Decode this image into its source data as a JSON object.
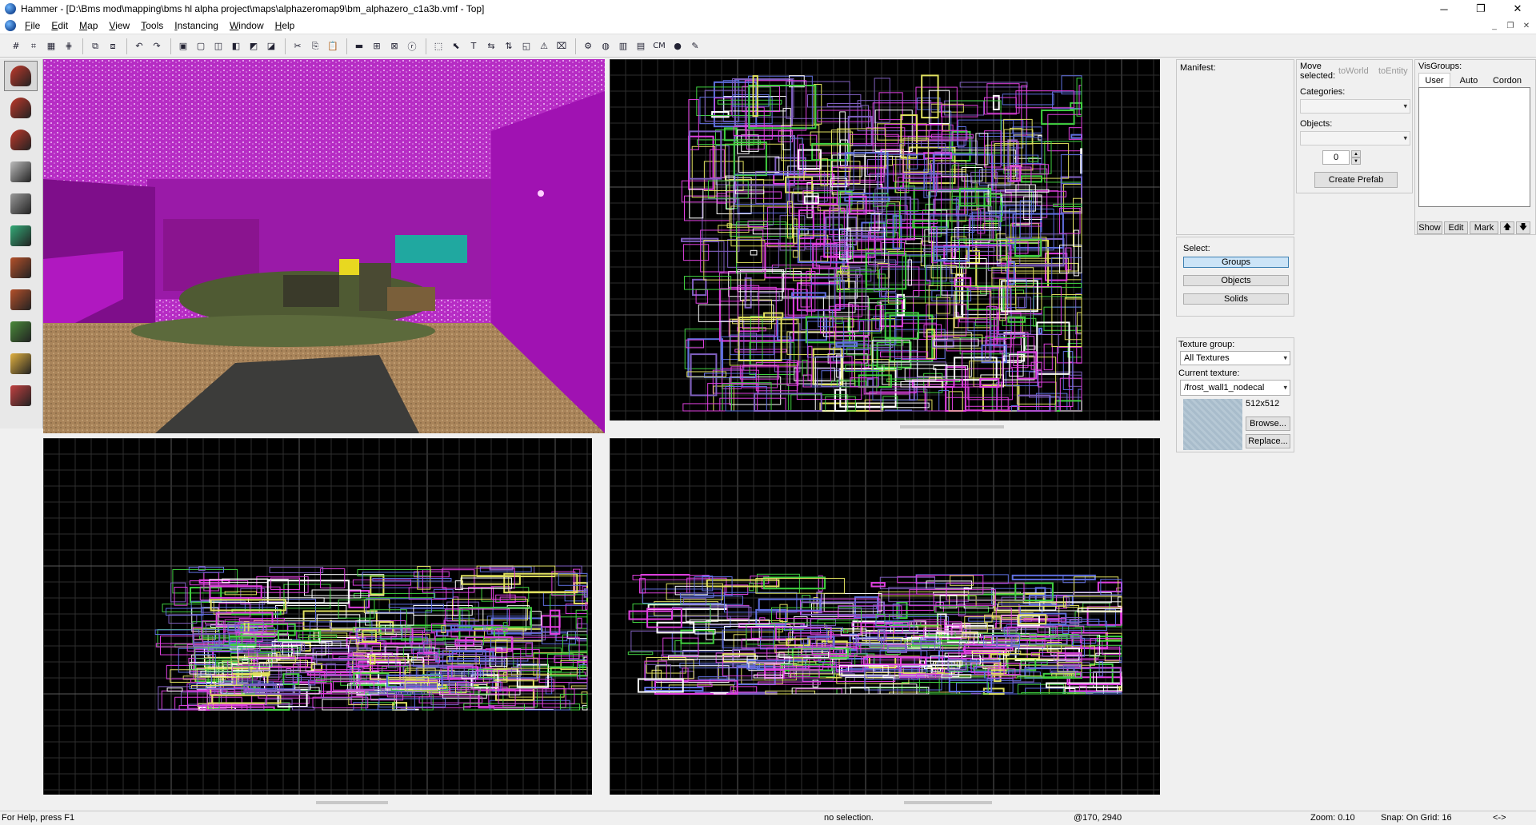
{
  "window": {
    "title": "Hammer - [D:\\Bms mod\\mapping\\bms hl alpha project\\maps\\alphazeromap9\\bm_alphazero_c1a3b.vmf - Top]",
    "controls": {
      "minimize": "─",
      "restore": "❐",
      "close": "✕"
    }
  },
  "menu": [
    "File",
    "Edit",
    "Map",
    "View",
    "Tools",
    "Instancing",
    "Window",
    "Help"
  ],
  "mdi_controls": {
    "minimize": "_",
    "restore": "❐",
    "close": "✕"
  },
  "toolbar_icons": [
    "grid-toggle",
    "grid-3d",
    "grid-dots",
    "grid-hash",
    "group",
    "ungroup",
    "undo",
    "redo",
    "carve",
    "hollow",
    "tie-to-entity",
    "move-to-world",
    "hide",
    "unhide",
    "cut",
    "copy",
    "paste",
    "wireframe",
    "toggle-texlock",
    "toggle-texscale",
    "ignore-groups",
    "selection-box",
    "select-cursor",
    "text-tool",
    "flip-h",
    "flip-v",
    "entity-report",
    "check-problems",
    "cordon",
    "map-properties",
    "toggle-3d-grid",
    "toggle-models",
    "toggle-sprites",
    "cm",
    "compile",
    "draw-mode"
  ],
  "toolbar_text": {
    "cm": "CM"
  },
  "left_tools": [
    {
      "name": "selection-tool-icon",
      "color": "#c0392b"
    },
    {
      "name": "magnify-tool-icon",
      "color": "#c0392b"
    },
    {
      "name": "camera-tool-icon",
      "color": "#c0392b"
    },
    {
      "name": "entity-tool-icon",
      "color": "#bbbbbb"
    },
    {
      "name": "block-tool-icon",
      "color": "#999999"
    },
    {
      "name": "texture-application-icon",
      "color": "#3a7"
    },
    {
      "name": "apply-texture-icon",
      "color": "#b4502a"
    },
    {
      "name": "decal-tool-icon",
      "color": "#b4502a"
    },
    {
      "name": "overlay-tool-icon",
      "color": "#4a8a3a"
    },
    {
      "name": "clipping-tool-icon",
      "color": "#e0b040"
    },
    {
      "name": "vertex-tool-icon",
      "color": "#c04040"
    }
  ],
  "right_panel": {
    "manifest_label": "Manifest:",
    "move_selected_label": "Move selected:",
    "to_world": "toWorld",
    "to_entity": "toEntity",
    "categories_label": "Categories:",
    "objects_label": "Objects:",
    "objects_count": "0",
    "create_prefab": "Create Prefab",
    "visgroups_label": "VisGroups:",
    "visgroup_tabs": [
      "User",
      "Auto",
      "Cordon"
    ],
    "visgroup_buttons": [
      "Show",
      "Edit",
      "Mark"
    ],
    "visgroup_arrows": [
      "🡅",
      "🡇"
    ],
    "select_label": "Select:",
    "select_buttons": [
      "Groups",
      "Objects",
      "Solids"
    ],
    "texture_group_label": "Texture group:",
    "texture_group_value": "All Textures",
    "current_texture_label": "Current texture:",
    "current_texture_value": "/frost_wall1_nodecal",
    "texture_size": "512x512",
    "browse": "Browse...",
    "replace": "Replace..."
  },
  "status": {
    "help": "For Help, press F1",
    "selection": "no selection.",
    "coords": "@170, 2940",
    "zoom": "Zoom: 0.10",
    "snap": "Snap: On Grid: 16",
    "arrows": "<->"
  },
  "colors": {
    "viewport_bg": "#000000",
    "grid_minor": "#2e2e2e",
    "grid_major": "#5a5a5a",
    "brush_magenta": "#e040e0",
    "brush_green": "#40d040",
    "brush_yellow": "#e0e060",
    "brush_purple": "#8060c0",
    "brush_blue": "#6070e0",
    "world_magenta": "#a816b8"
  }
}
